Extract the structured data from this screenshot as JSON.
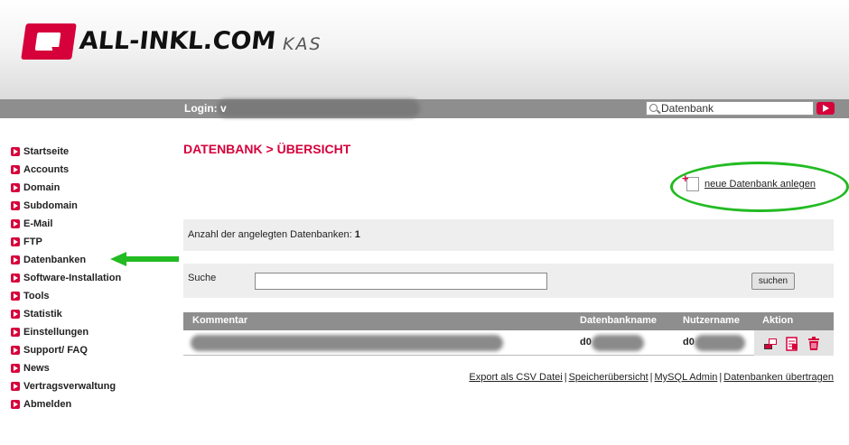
{
  "header": {
    "logo_text": "ALL-INKL.COM",
    "logo_sub": "KAS"
  },
  "topbar": {
    "login_label": "Login: v",
    "search_value": "Datenbank"
  },
  "sidebar": {
    "items": [
      {
        "label": "Startseite"
      },
      {
        "label": "Accounts"
      },
      {
        "label": "Domain"
      },
      {
        "label": "Subdomain"
      },
      {
        "label": "E-Mail"
      },
      {
        "label": "FTP"
      },
      {
        "label": "Datenbanken"
      },
      {
        "label": "Software-Installation"
      },
      {
        "label": "Tools"
      },
      {
        "label": "Statistik"
      },
      {
        "label": "Einstellungen"
      },
      {
        "label": "Support/ FAQ"
      },
      {
        "label": "News"
      },
      {
        "label": "Vertragsverwaltung"
      },
      {
        "label": "Abmelden"
      }
    ]
  },
  "main": {
    "title": "DATENBANK > ÜBERSICHT",
    "new_db_link": "neue Datenbank anlegen",
    "count_label": "Anzahl der angelegten Datenbanken:",
    "count_value": "1",
    "search_label": "Suche",
    "search_button": "suchen",
    "table": {
      "headers": [
        "Kommentar",
        "Datenbankname",
        "Nutzername",
        "Aktion"
      ],
      "rows": [
        {
          "db_prefix": "d0",
          "user_prefix": "d0"
        }
      ]
    },
    "footer_links": [
      "Export als CSV Datei",
      "Speicherübersicht",
      "MySQL Admin",
      "Datenbanken übertragen"
    ]
  },
  "colors": {
    "brand": "#d6003b",
    "annotation": "#22bb22",
    "bar": "#8e8e8e"
  }
}
